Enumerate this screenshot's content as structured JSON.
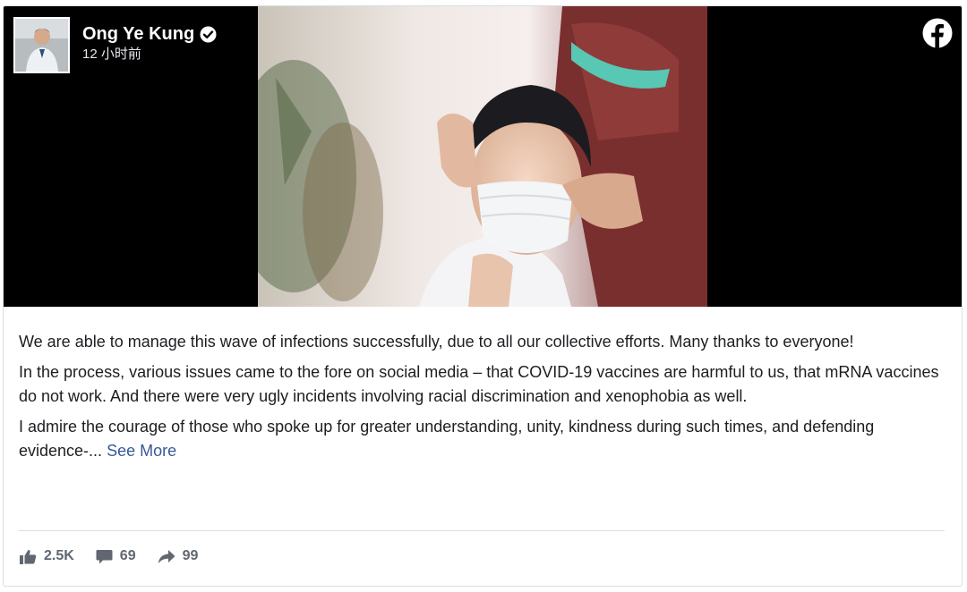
{
  "post": {
    "author_name": "Ong Ye Kung",
    "timestamp": "12 小时前",
    "verified_icon": "verified-badge-icon",
    "platform_icon": "facebook-logo-icon",
    "paragraphs": [
      "We are able to manage this wave of infections successfully, due to all our collective efforts. Many thanks to everyone!",
      "In the process, various issues came to the fore on social media – that COVID-19 vaccines are harmful to us, that mRNA vaccines do not work. And there were very ugly incidents involving racial discrimination and xenophobia as well.",
      "I admire the courage of those who spoke up for greater understanding, unity, kindness during such times, and defending evidence-..."
    ],
    "see_more_label": "See More"
  },
  "stats": {
    "likes": "2.5K",
    "comments": "69",
    "shares": "99"
  },
  "colors": {
    "text": "#1c1e21",
    "link": "#385898",
    "meta": "#606770",
    "border": "#dadde1",
    "media_bg": "#000000"
  }
}
